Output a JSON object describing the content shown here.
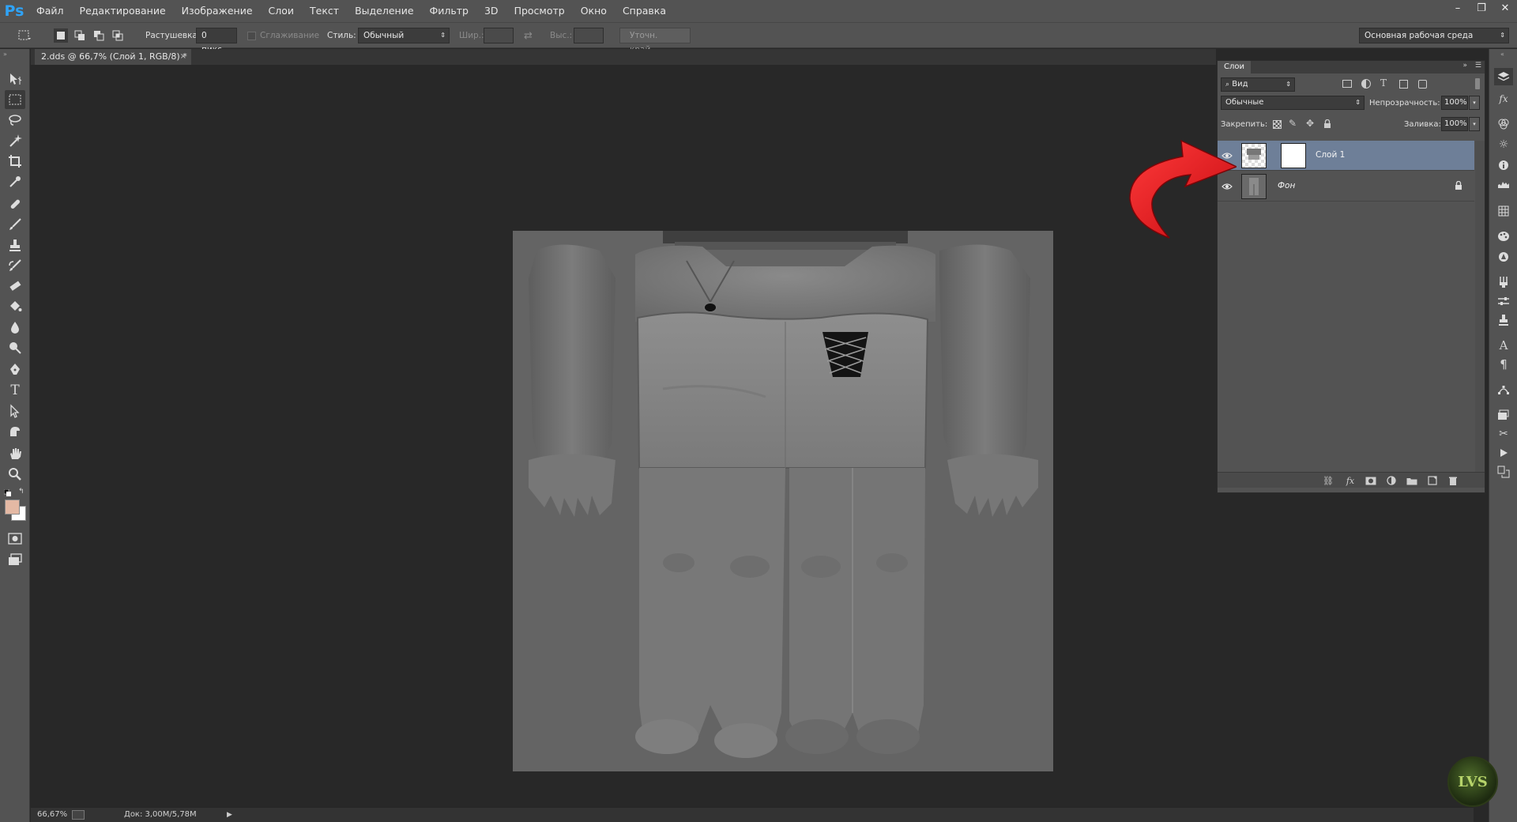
{
  "app": {
    "logo": "Ps"
  },
  "menu": [
    "Файл",
    "Редактирование",
    "Изображение",
    "Слои",
    "Текст",
    "Выделение",
    "Фильтр",
    "3D",
    "Просмотр",
    "Окно",
    "Справка"
  ],
  "window_controls": [
    "–",
    "❐",
    "✕"
  ],
  "options": {
    "feather_label": "Растушевка:",
    "feather_value": "0 пикс.",
    "antialias_label": "Сглаживание",
    "style_label": "Стиль:",
    "style_value": "Обычный",
    "width_label": "Шир.:",
    "height_label": "Выс.:",
    "refine_button": "Уточн. край...",
    "workspace_value": "Основная рабочая среда"
  },
  "document": {
    "tab_title": "2.dds @ 66,7% (Слой 1, RGB/8) *",
    "tab_close": "×"
  },
  "status": {
    "zoom": "66,67%",
    "doc": "Док: 3,00M/5,78M"
  },
  "layers_panel": {
    "tab": "Слои",
    "filter_value": "Вид",
    "blend_mode": "Обычные",
    "opacity_label": "Непрозрачность:",
    "opacity_value": "100%",
    "lock_label": "Закрепить:",
    "fill_label": "Заливка:",
    "fill_value": "100%",
    "layers": [
      {
        "name": "Слой 1",
        "selected": true
      },
      {
        "name": "Фон",
        "selected": false,
        "locked": true
      }
    ]
  },
  "watermark": "LVS",
  "colors": {
    "foreground": "#e4b9a4",
    "background": "#ffffff",
    "selection": "#6e7f98",
    "arrow": "#e1141b"
  }
}
